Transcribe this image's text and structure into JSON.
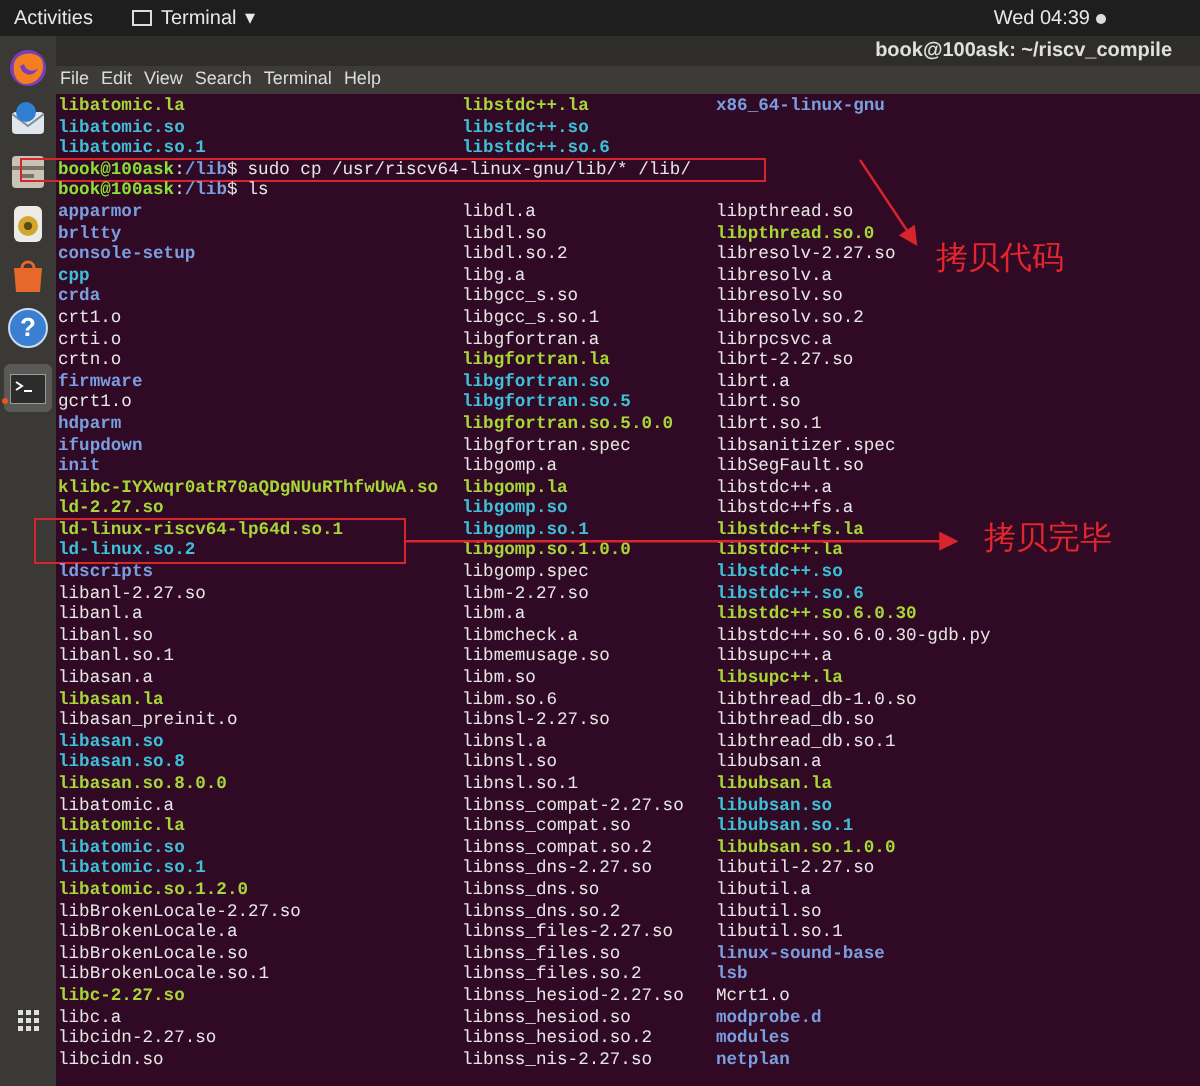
{
  "top_bar": {
    "activities": "Activities",
    "app_menu": "Terminal",
    "app_menu_caret": "▾",
    "clock": "Wed 04:39"
  },
  "dock": {
    "help_glyph": "?"
  },
  "window": {
    "title": "book@100ask: ~/riscv_compile"
  },
  "menu": [
    "File",
    "Edit",
    "View",
    "Search",
    "Terminal",
    "Help"
  ],
  "previous_output": [
    [
      {
        "name": "libatomic.la",
        "kind": "exec"
      },
      {
        "name": "libstdc++.la",
        "kind": "exec"
      },
      {
        "name": "x86_64-linux-gnu",
        "kind": "dir"
      }
    ],
    [
      {
        "name": "libatomic.so",
        "kind": "link"
      },
      {
        "name": "libstdc++.so",
        "kind": "link"
      }
    ],
    [
      {
        "name": "libatomic.so.1",
        "kind": "link"
      },
      {
        "name": "libstdc++.so.6",
        "kind": "link"
      }
    ]
  ],
  "commands": [
    {
      "user": "book@100ask",
      "sep": ":",
      "path": "/lib",
      "sign": "$",
      "command": "sudo cp /usr/riscv64-linux-gnu/lib/* /lib/"
    },
    {
      "user": "book@100ask",
      "sep": ":",
      "path": "/lib",
      "sign": "$",
      "command": "ls"
    }
  ],
  "listing": {
    "columns": [
      [
        {
          "name": "apparmor",
          "kind": "dir"
        },
        {
          "name": "brltty",
          "kind": "dir"
        },
        {
          "name": "console-setup",
          "kind": "dir"
        },
        {
          "name": "cpp",
          "kind": "link"
        },
        {
          "name": "crda",
          "kind": "dir"
        },
        {
          "name": "crt1.o",
          "kind": "file"
        },
        {
          "name": "crti.o",
          "kind": "file"
        },
        {
          "name": "crtn.o",
          "kind": "file"
        },
        {
          "name": "firmware",
          "kind": "dir"
        },
        {
          "name": "gcrt1.o",
          "kind": "file"
        },
        {
          "name": "hdparm",
          "kind": "dir"
        },
        {
          "name": "ifupdown",
          "kind": "dir"
        },
        {
          "name": "init",
          "kind": "dir"
        },
        {
          "name": "klibc-IYXwqr0atR70aQDgNUuRThfwUwA.so",
          "kind": "exec"
        },
        {
          "name": "ld-2.27.so",
          "kind": "exec"
        },
        {
          "name": "ld-linux-riscv64-lp64d.so.1",
          "kind": "exec"
        },
        {
          "name": "ld-linux.so.2",
          "kind": "link"
        },
        {
          "name": "ldscripts",
          "kind": "dir"
        },
        {
          "name": "libanl-2.27.so",
          "kind": "file"
        },
        {
          "name": "libanl.a",
          "kind": "file"
        },
        {
          "name": "libanl.so",
          "kind": "file"
        },
        {
          "name": "libanl.so.1",
          "kind": "file"
        },
        {
          "name": "libasan.a",
          "kind": "file"
        },
        {
          "name": "libasan.la",
          "kind": "exec"
        },
        {
          "name": "libasan_preinit.o",
          "kind": "file"
        },
        {
          "name": "libasan.so",
          "kind": "link"
        },
        {
          "name": "libasan.so.8",
          "kind": "link"
        },
        {
          "name": "libasan.so.8.0.0",
          "kind": "exec"
        },
        {
          "name": "libatomic.a",
          "kind": "file"
        },
        {
          "name": "libatomic.la",
          "kind": "exec"
        },
        {
          "name": "libatomic.so",
          "kind": "link"
        },
        {
          "name": "libatomic.so.1",
          "kind": "link"
        },
        {
          "name": "libatomic.so.1.2.0",
          "kind": "exec"
        },
        {
          "name": "libBrokenLocale-2.27.so",
          "kind": "file"
        },
        {
          "name": "libBrokenLocale.a",
          "kind": "file"
        },
        {
          "name": "libBrokenLocale.so",
          "kind": "file"
        },
        {
          "name": "libBrokenLocale.so.1",
          "kind": "file"
        },
        {
          "name": "libc-2.27.so",
          "kind": "exec"
        },
        {
          "name": "libc.a",
          "kind": "file"
        },
        {
          "name": "libcidn-2.27.so",
          "kind": "file"
        },
        {
          "name": "libcidn.so",
          "kind": "file"
        }
      ],
      [
        {
          "name": "libdl.a",
          "kind": "file"
        },
        {
          "name": "libdl.so",
          "kind": "file"
        },
        {
          "name": "libdl.so.2",
          "kind": "file"
        },
        {
          "name": "libg.a",
          "kind": "file"
        },
        {
          "name": "libgcc_s.so",
          "kind": "file"
        },
        {
          "name": "libgcc_s.so.1",
          "kind": "file"
        },
        {
          "name": "libgfortran.a",
          "kind": "file"
        },
        {
          "name": "libgfortran.la",
          "kind": "exec"
        },
        {
          "name": "libgfortran.so",
          "kind": "link"
        },
        {
          "name": "libgfortran.so.5",
          "kind": "link"
        },
        {
          "name": "libgfortran.so.5.0.0",
          "kind": "exec"
        },
        {
          "name": "libgfortran.spec",
          "kind": "file"
        },
        {
          "name": "libgomp.a",
          "kind": "file"
        },
        {
          "name": "libgomp.la",
          "kind": "exec"
        },
        {
          "name": "libgomp.so",
          "kind": "link"
        },
        {
          "name": "libgomp.so.1",
          "kind": "link"
        },
        {
          "name": "libgomp.so.1.0.0",
          "kind": "exec"
        },
        {
          "name": "libgomp.spec",
          "kind": "file"
        },
        {
          "name": "libm-2.27.so",
          "kind": "file"
        },
        {
          "name": "libm.a",
          "kind": "file"
        },
        {
          "name": "libmcheck.a",
          "kind": "file"
        },
        {
          "name": "libmemusage.so",
          "kind": "file"
        },
        {
          "name": "libm.so",
          "kind": "file"
        },
        {
          "name": "libm.so.6",
          "kind": "file"
        },
        {
          "name": "libnsl-2.27.so",
          "kind": "file"
        },
        {
          "name": "libnsl.a",
          "kind": "file"
        },
        {
          "name": "libnsl.so",
          "kind": "file"
        },
        {
          "name": "libnsl.so.1",
          "kind": "file"
        },
        {
          "name": "libnss_compat-2.27.so",
          "kind": "file"
        },
        {
          "name": "libnss_compat.so",
          "kind": "file"
        },
        {
          "name": "libnss_compat.so.2",
          "kind": "file"
        },
        {
          "name": "libnss_dns-2.27.so",
          "kind": "file"
        },
        {
          "name": "libnss_dns.so",
          "kind": "file"
        },
        {
          "name": "libnss_dns.so.2",
          "kind": "file"
        },
        {
          "name": "libnss_files-2.27.so",
          "kind": "file"
        },
        {
          "name": "libnss_files.so",
          "kind": "file"
        },
        {
          "name": "libnss_files.so.2",
          "kind": "file"
        },
        {
          "name": "libnss_hesiod-2.27.so",
          "kind": "file"
        },
        {
          "name": "libnss_hesiod.so",
          "kind": "file"
        },
        {
          "name": "libnss_hesiod.so.2",
          "kind": "file"
        },
        {
          "name": "libnss_nis-2.27.so",
          "kind": "file"
        }
      ],
      [
        {
          "name": "libpthread.so",
          "kind": "file"
        },
        {
          "name": "libpthread.so.0",
          "kind": "exec"
        },
        {
          "name": "libresolv-2.27.so",
          "kind": "file"
        },
        {
          "name": "libresolv.a",
          "kind": "file"
        },
        {
          "name": "libresolv.so",
          "kind": "file"
        },
        {
          "name": "libresolv.so.2",
          "kind": "file"
        },
        {
          "name": "librpcsvc.a",
          "kind": "file"
        },
        {
          "name": "librt-2.27.so",
          "kind": "file"
        },
        {
          "name": "librt.a",
          "kind": "file"
        },
        {
          "name": "librt.so",
          "kind": "file"
        },
        {
          "name": "librt.so.1",
          "kind": "file"
        },
        {
          "name": "libsanitizer.spec",
          "kind": "file"
        },
        {
          "name": "libSegFault.so",
          "kind": "file"
        },
        {
          "name": "libstdc++.a",
          "kind": "file"
        },
        {
          "name": "libstdc++fs.a",
          "kind": "file"
        },
        {
          "name": "libstdc++fs.la",
          "kind": "exec"
        },
        {
          "name": "libstdc++.la",
          "kind": "exec"
        },
        {
          "name": "libstdc++.so",
          "kind": "link"
        },
        {
          "name": "libstdc++.so.6",
          "kind": "link"
        },
        {
          "name": "libstdc++.so.6.0.30",
          "kind": "exec"
        },
        {
          "name": "libstdc++.so.6.0.30-gdb.py",
          "kind": "file"
        },
        {
          "name": "libsupc++.a",
          "kind": "file"
        },
        {
          "name": "libsupc++.la",
          "kind": "exec"
        },
        {
          "name": "libthread_db-1.0.so",
          "kind": "file"
        },
        {
          "name": "libthread_db.so",
          "kind": "file"
        },
        {
          "name": "libthread_db.so.1",
          "kind": "file"
        },
        {
          "name": "libubsan.a",
          "kind": "file"
        },
        {
          "name": "libubsan.la",
          "kind": "exec"
        },
        {
          "name": "libubsan.so",
          "kind": "link"
        },
        {
          "name": "libubsan.so.1",
          "kind": "link"
        },
        {
          "name": "libubsan.so.1.0.0",
          "kind": "exec"
        },
        {
          "name": "libutil-2.27.so",
          "kind": "file"
        },
        {
          "name": "libutil.a",
          "kind": "file"
        },
        {
          "name": "libutil.so",
          "kind": "file"
        },
        {
          "name": "libutil.so.1",
          "kind": "file"
        },
        {
          "name": "linux-sound-base",
          "kind": "dir"
        },
        {
          "name": "lsb",
          "kind": "dir"
        },
        {
          "name": "Mcrt1.o",
          "kind": "file"
        },
        {
          "name": "modprobe.d",
          "kind": "dir"
        },
        {
          "name": "modules",
          "kind": "dir"
        },
        {
          "name": "netplan",
          "kind": "dir"
        }
      ]
    ]
  },
  "annotations": [
    {
      "label": "拷贝代码"
    },
    {
      "label": "拷贝完毕"
    }
  ]
}
